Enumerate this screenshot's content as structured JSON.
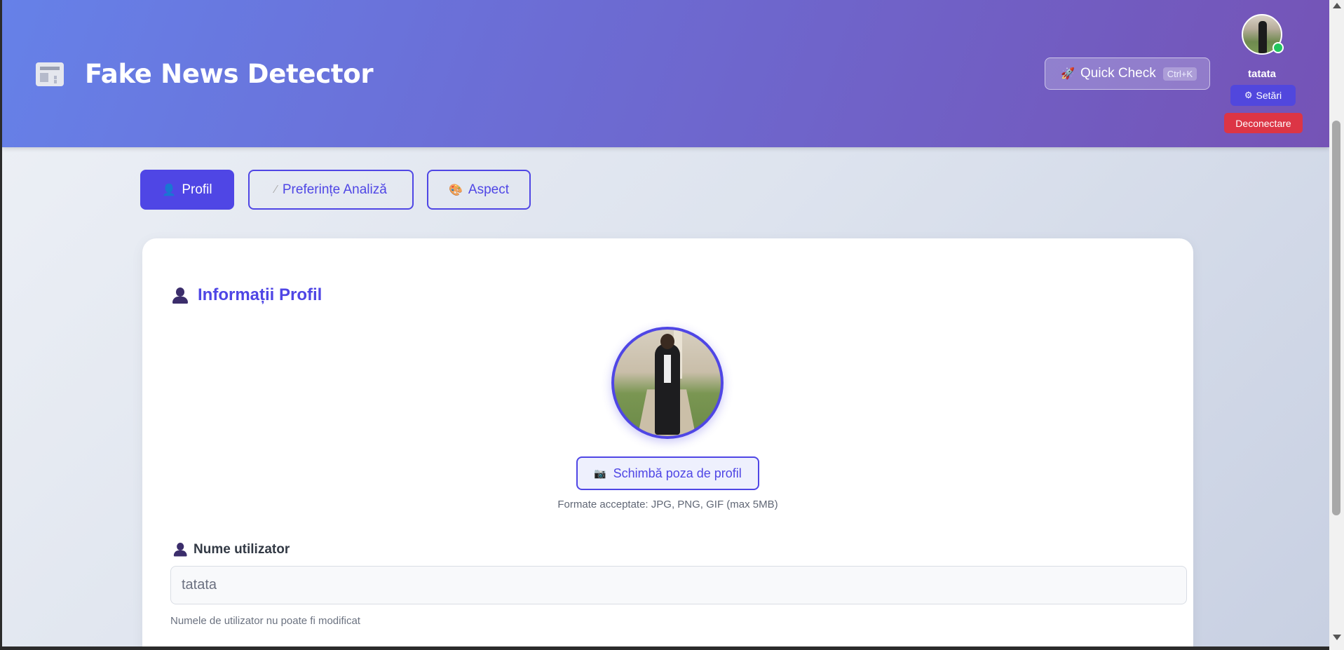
{
  "header": {
    "title": "Fake News Detector",
    "logo_icon": "newspaper-icon",
    "quick_check": {
      "label": "Quick Check",
      "shortcut": "Ctrl+K",
      "icon": "rocket-icon"
    },
    "user": {
      "name": "tatata",
      "status_color": "#22c55e",
      "settings_label": "Setări",
      "settings_icon": "gear-icon",
      "logout_label": "Deconectare"
    }
  },
  "tabs": [
    {
      "label": "Profil",
      "icon": "person-icon",
      "active": true
    },
    {
      "label": "Preferințe Analiză",
      "icon": "bone-icon",
      "active": false
    },
    {
      "label": "Aspect",
      "icon": "palette-icon",
      "active": false
    }
  ],
  "profile_section": {
    "title": "Informații Profil",
    "change_photo_label": "Schimbă poza de profil",
    "photo_icon": "camera-icon",
    "formats_note": "Formate acceptate: JPG, PNG, GIF (max 5MB)",
    "username_field": {
      "label": "Nume utilizator",
      "value": "tatata",
      "help": "Numele de utilizator nu poate fi modificat"
    }
  },
  "colors": {
    "accent": "#4f46e5",
    "header_gradient_start": "#6681e8",
    "header_gradient_end": "#7553b6",
    "logout": "#dc3545"
  }
}
